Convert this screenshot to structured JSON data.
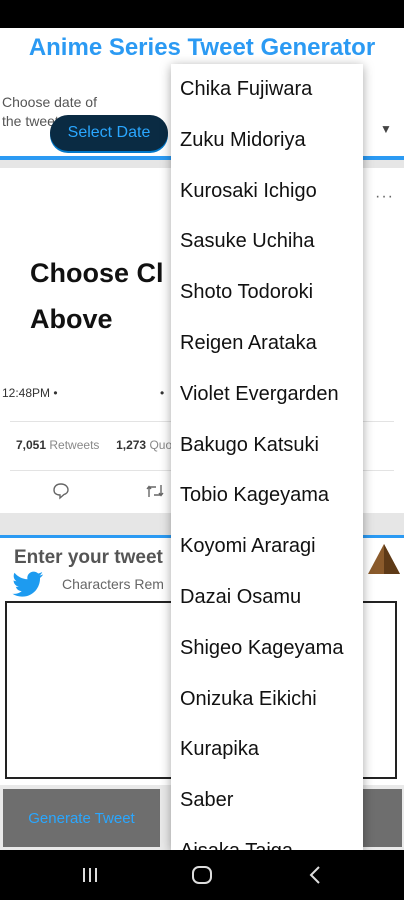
{
  "app": {
    "title": "Anime Series Tweet Generator"
  },
  "date_picker": {
    "label": "Choose date of the tweet:",
    "button_label": "Select Date",
    "dropdown_icon": "caret-down-icon"
  },
  "tweet_preview": {
    "text": "Choose Cl Above",
    "time": "12:48PM •",
    "dot": "•",
    "retweets_count": "7,051",
    "retweets_label": "Retweets",
    "quotes_count": "1,273",
    "quotes_label": "Quote",
    "more_icon": "more-dots-icon",
    "actions": [
      "reply-icon",
      "retweet-icon"
    ]
  },
  "composer": {
    "label": "Enter your tweet",
    "chars_remaining_label": "Characters Rem",
    "bird_icon": "twitter-bird-icon"
  },
  "generate": {
    "button_label": "Generate Tweet"
  },
  "character_dropdown": {
    "items": [
      "Chika Fujiwara",
      "Zuku Midoriya",
      "Kurosaki Ichigo",
      "Sasuke Uchiha",
      "Shoto Todoroki",
      "Reigen Arataka",
      "Violet Evergarden",
      "Bakugo Katsuki",
      "Tobio Kageyama",
      "Koyomi Araragi",
      "Dazai Osamu",
      "Shigeo Kageyama",
      "Onizuka Eikichi",
      "Kurapika",
      "Saber",
      "Aisaka Taiga"
    ]
  },
  "colors": {
    "accent": "#2b9af3",
    "button_dark": "#0a2b43",
    "button_gray": "#6e6e6e"
  }
}
